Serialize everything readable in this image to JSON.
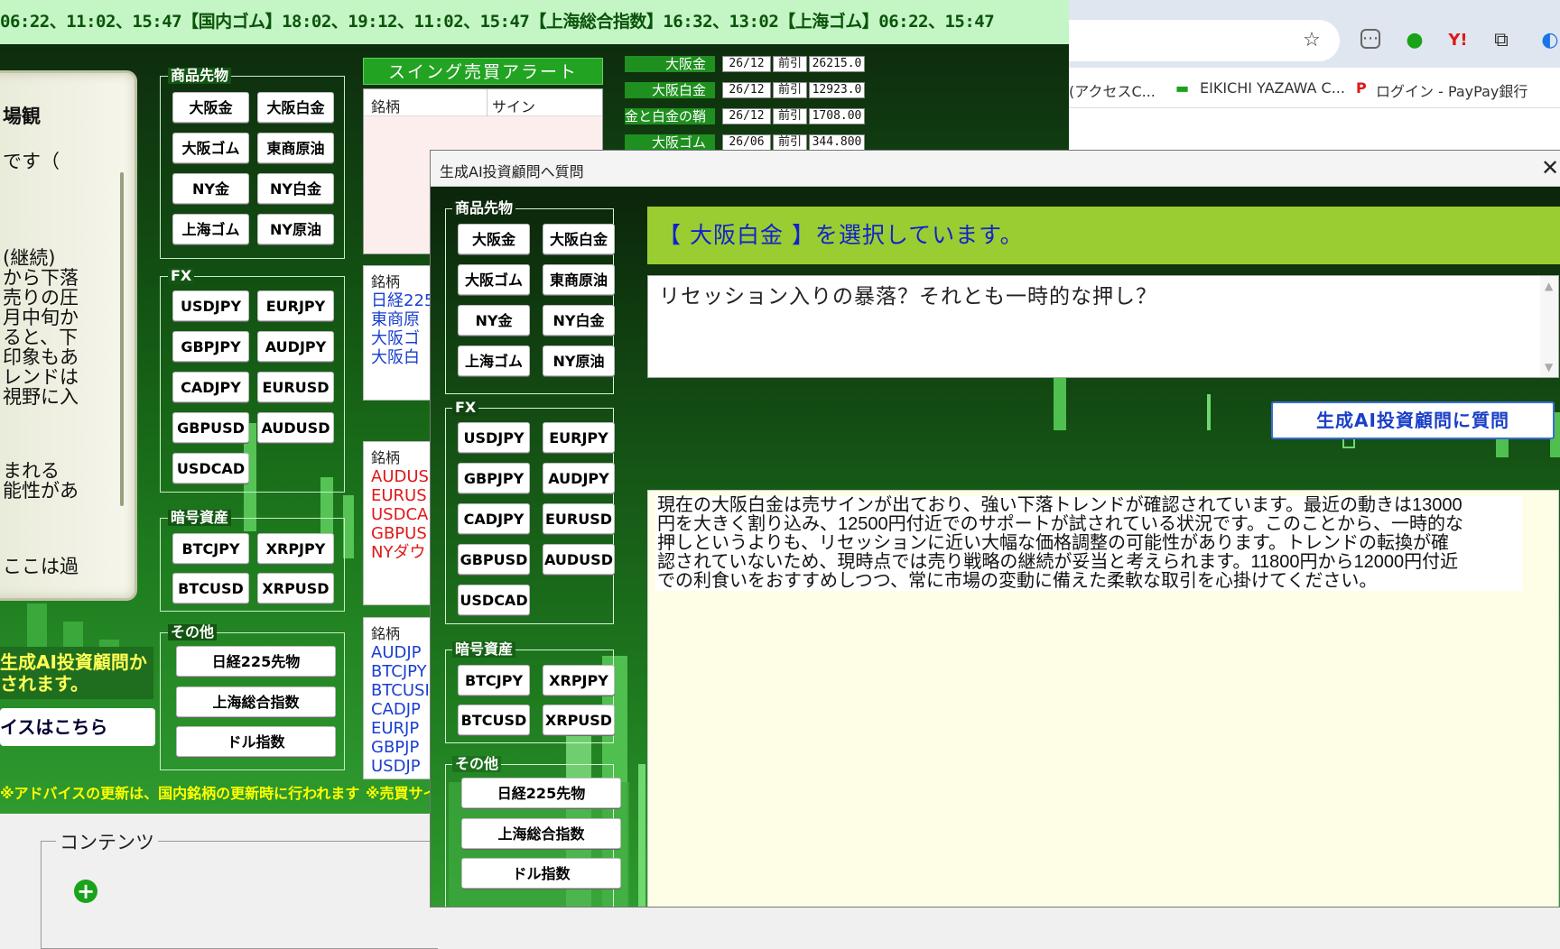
{
  "ticker": "06:22、11:02、15:47【国内ゴム】18:02、19:12、11:02、15:47【上海総合指数】16:32、13:02【上海ゴム】06:22、15:47",
  "left_card": {
    "lines": [
      "場観",
      "です（",
      "(継続)",
      "から下落",
      "売りの圧",
      "月中旬か",
      "ると、下",
      "印象もあ",
      "レンドは",
      "視野に入",
      "まれる",
      "能性があ",
      "ここは過"
    ]
  },
  "left_banner": "生成AI投資顧問か\nされます。",
  "left_advice_button": "イスはこちら",
  "left_note": "※アドバイスの更新は、国内銘柄の更新時に行われます",
  "mid_note": "※売買サイ",
  "groups": {
    "commodities": "商品先物",
    "fx": "FX",
    "crypto": "暗号資産",
    "other": "その他"
  },
  "commodity_buttons": [
    "大阪金",
    "大阪白金",
    "大阪ゴム",
    "東商原油",
    "NY金",
    "NY白金",
    "上海ゴム",
    "NY原油"
  ],
  "fx_buttons": [
    "USDJPY",
    "EURJPY",
    "GBPJPY",
    "AUDJPY",
    "CADJPY",
    "EURUSD",
    "GBPUSD",
    "AUDUSD",
    "USDCAD"
  ],
  "crypto_buttons": [
    "BTCJPY",
    "XRPJPY",
    "BTCUSD",
    "XRPUSD"
  ],
  "other_buttons": [
    "日経225先物",
    "上海総合指数",
    "ドル指数"
  ],
  "swing_alert": {
    "title": "スイング売買アラート",
    "col_symbol": "銘柄",
    "col_sign": "サイン"
  },
  "list1": {
    "header": "銘柄",
    "items": [
      "日経225",
      "東商原",
      "大阪ゴ",
      "大阪白"
    ],
    "color": "#1a3fd0"
  },
  "list2": {
    "header": "銘柄",
    "items": [
      "AUDUS",
      "EURUS",
      "USDCA",
      "GBPUS",
      "NYダウ"
    ],
    "color": "#e01818"
  },
  "list3": {
    "header": "銘柄",
    "items": [
      "AUDJP",
      "BTCJPY",
      "BTCUSI",
      "CADJP",
      "EURJP",
      "GBPJP",
      "USDJP"
    ],
    "color": "#1a3fd0"
  },
  "quotes": [
    {
      "name": "大阪金",
      "date": "26/12",
      "type": "前引",
      "price": "26215.0"
    },
    {
      "name": "大阪白金",
      "date": "26/12",
      "type": "前引",
      "price": "12923.0"
    },
    {
      "name": "金と白金の鞘",
      "date": "26/12",
      "type": "前引",
      "price": "1708.00"
    },
    {
      "name": "大阪ゴム",
      "date": "26/06",
      "type": "前引",
      "price": "344.800"
    }
  ],
  "browser": {
    "bookmarks": [
      "(アクセスC...",
      "EIKICHI YAZAWA C...",
      "ログイン - PayPay銀行"
    ]
  },
  "content_label": "コンテンツ",
  "dialog": {
    "title": "生成AI投資顧問へ質問",
    "close": "✕",
    "selected": "【 大阪白金 】を選択しています。",
    "question": "リセッション入りの暴落？それとも一時的な押し？",
    "ask_button": "生成AI投資顧問に質問",
    "answer_lines": [
      "現在の大阪白金は売サインが出ており、強い下落トレンドが確認されています。最近の動きは13000",
      "円を大きく割り込み、12500円付近でのサポートが試されている状況です。このことから、一時的な",
      "押しというよりも、リセッションに近い大幅な価格調整の可能性があります。トレンドの転換が確",
      "認されていないため、現時点では売り戦略の継続が妥当と考えられます。11800円から12000円付近",
      "での利食いをおすすめしつつ、常に市場の変動に備えた柔軟な取引を心掛けてください。"
    ]
  },
  "colors": {
    "ticker_bg": "#c4f5c4",
    "banner_bg": "#9acd32",
    "banner_text": "#1122cc",
    "app_green": "#135513"
  }
}
